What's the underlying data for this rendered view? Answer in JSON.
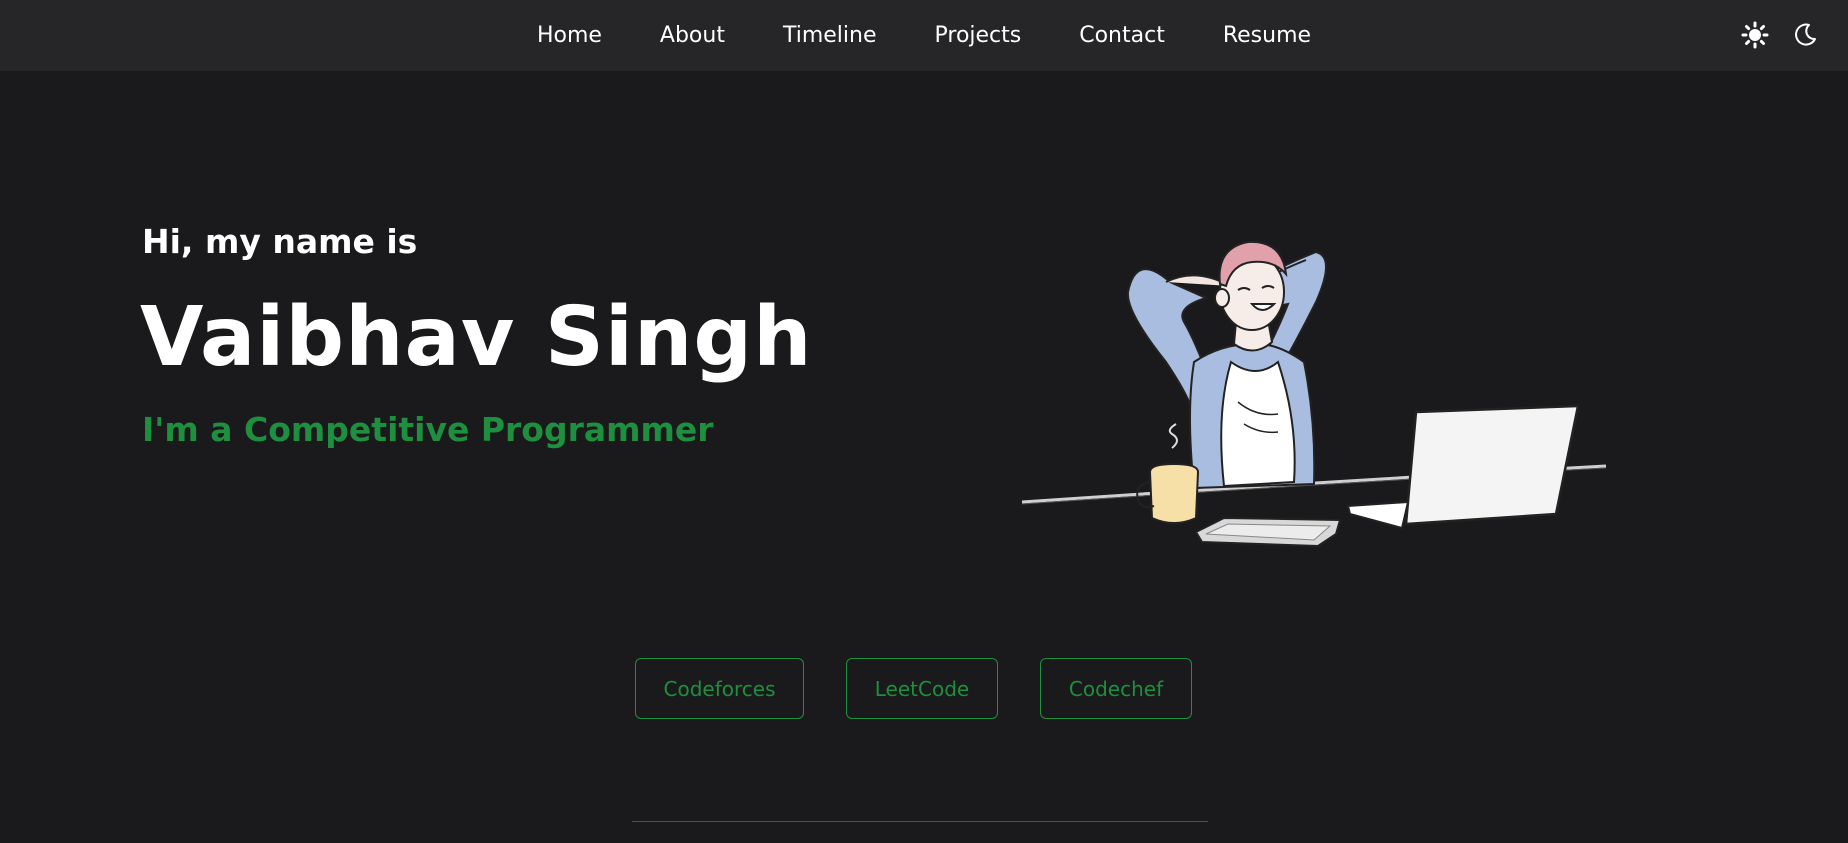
{
  "nav": {
    "items": [
      {
        "label": "Home"
      },
      {
        "label": "About"
      },
      {
        "label": "Timeline"
      },
      {
        "label": "Projects"
      },
      {
        "label": "Contact"
      },
      {
        "label": "Resume"
      }
    ],
    "theme_icons": [
      "sun-icon",
      "moon-icon"
    ]
  },
  "hero": {
    "greeting": "Hi, my name is",
    "name": "Vaibhav Singh",
    "role": "I'm a Competitive Programmer"
  },
  "profiles": [
    {
      "label": "Codeforces"
    },
    {
      "label": "LeetCode"
    },
    {
      "label": "Codechef"
    }
  ],
  "colors": {
    "background": "#1a1a1c",
    "navbar": "#262628",
    "accent": "#1e8f3e",
    "text": "#ffffff"
  }
}
